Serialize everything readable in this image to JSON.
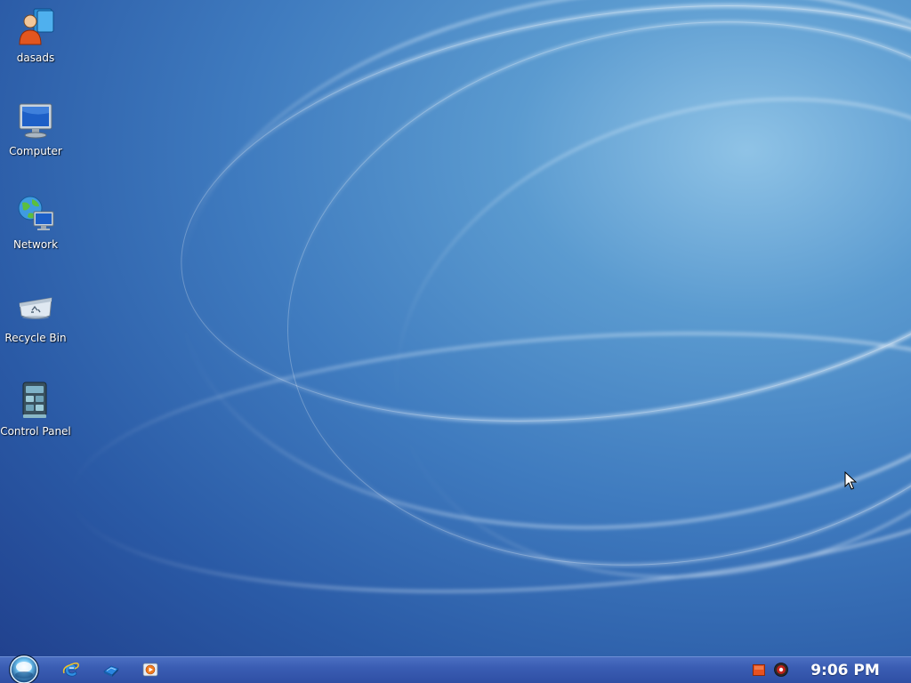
{
  "desktop": {
    "icons": [
      {
        "label": "dasads",
        "icon": "user-folder-icon"
      },
      {
        "label": "Computer",
        "icon": "computer-icon"
      },
      {
        "label": "Network",
        "icon": "network-icon"
      },
      {
        "label": "Recycle Bin",
        "icon": "recycle-bin-icon"
      },
      {
        "label": "Control Panel",
        "icon": "control-panel-icon"
      }
    ]
  },
  "taskbar": {
    "start_icon": "start-orb-icon",
    "quick_launch": [
      {
        "icon": "internet-explorer-icon"
      },
      {
        "icon": "show-desktop-icon"
      },
      {
        "icon": "media-player-icon"
      }
    ],
    "tray": {
      "icons": [
        "notification-flag-icon",
        "speaker-icon"
      ],
      "clock": "9:06 PM"
    }
  },
  "colors": {
    "taskbar": "#3a5db3",
    "wallpaper_dark": "#203f8c",
    "wallpaper_light": "#8fc3e6",
    "label_text": "#ffffff"
  }
}
